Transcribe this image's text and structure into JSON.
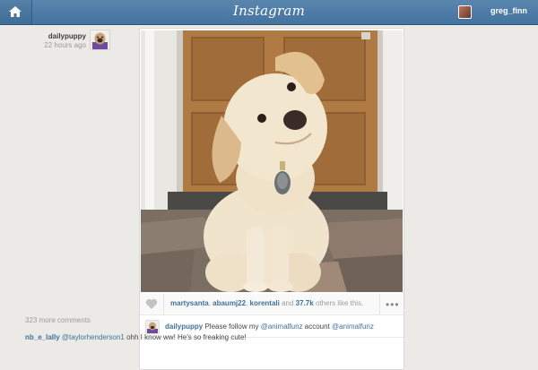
{
  "header": {
    "logo": "Instagram",
    "username": "greg_finn"
  },
  "post": {
    "author": "dailypuppy",
    "time": "22 hours ago",
    "likes": {
      "user1": "martysanta",
      "user2": "abaumj22",
      "user3": "korentali",
      "others": "37.7k",
      "suffix": "others like this."
    },
    "caption": {
      "user": "dailypuppy",
      "text": "Please follow my",
      "mention1": "@animalfunz",
      "text2": "account",
      "mention2": "@animalfunz"
    },
    "more_comments": "323 more comments",
    "comment": {
      "user": "nb_e_lally",
      "mention": "@taylorhenderson1",
      "text": "ohh I know ww! He's so freaking cute!"
    }
  },
  "colors": {
    "header": "#4d7ba6",
    "link": "#3f729b",
    "page_bg": "#ebeae6"
  }
}
